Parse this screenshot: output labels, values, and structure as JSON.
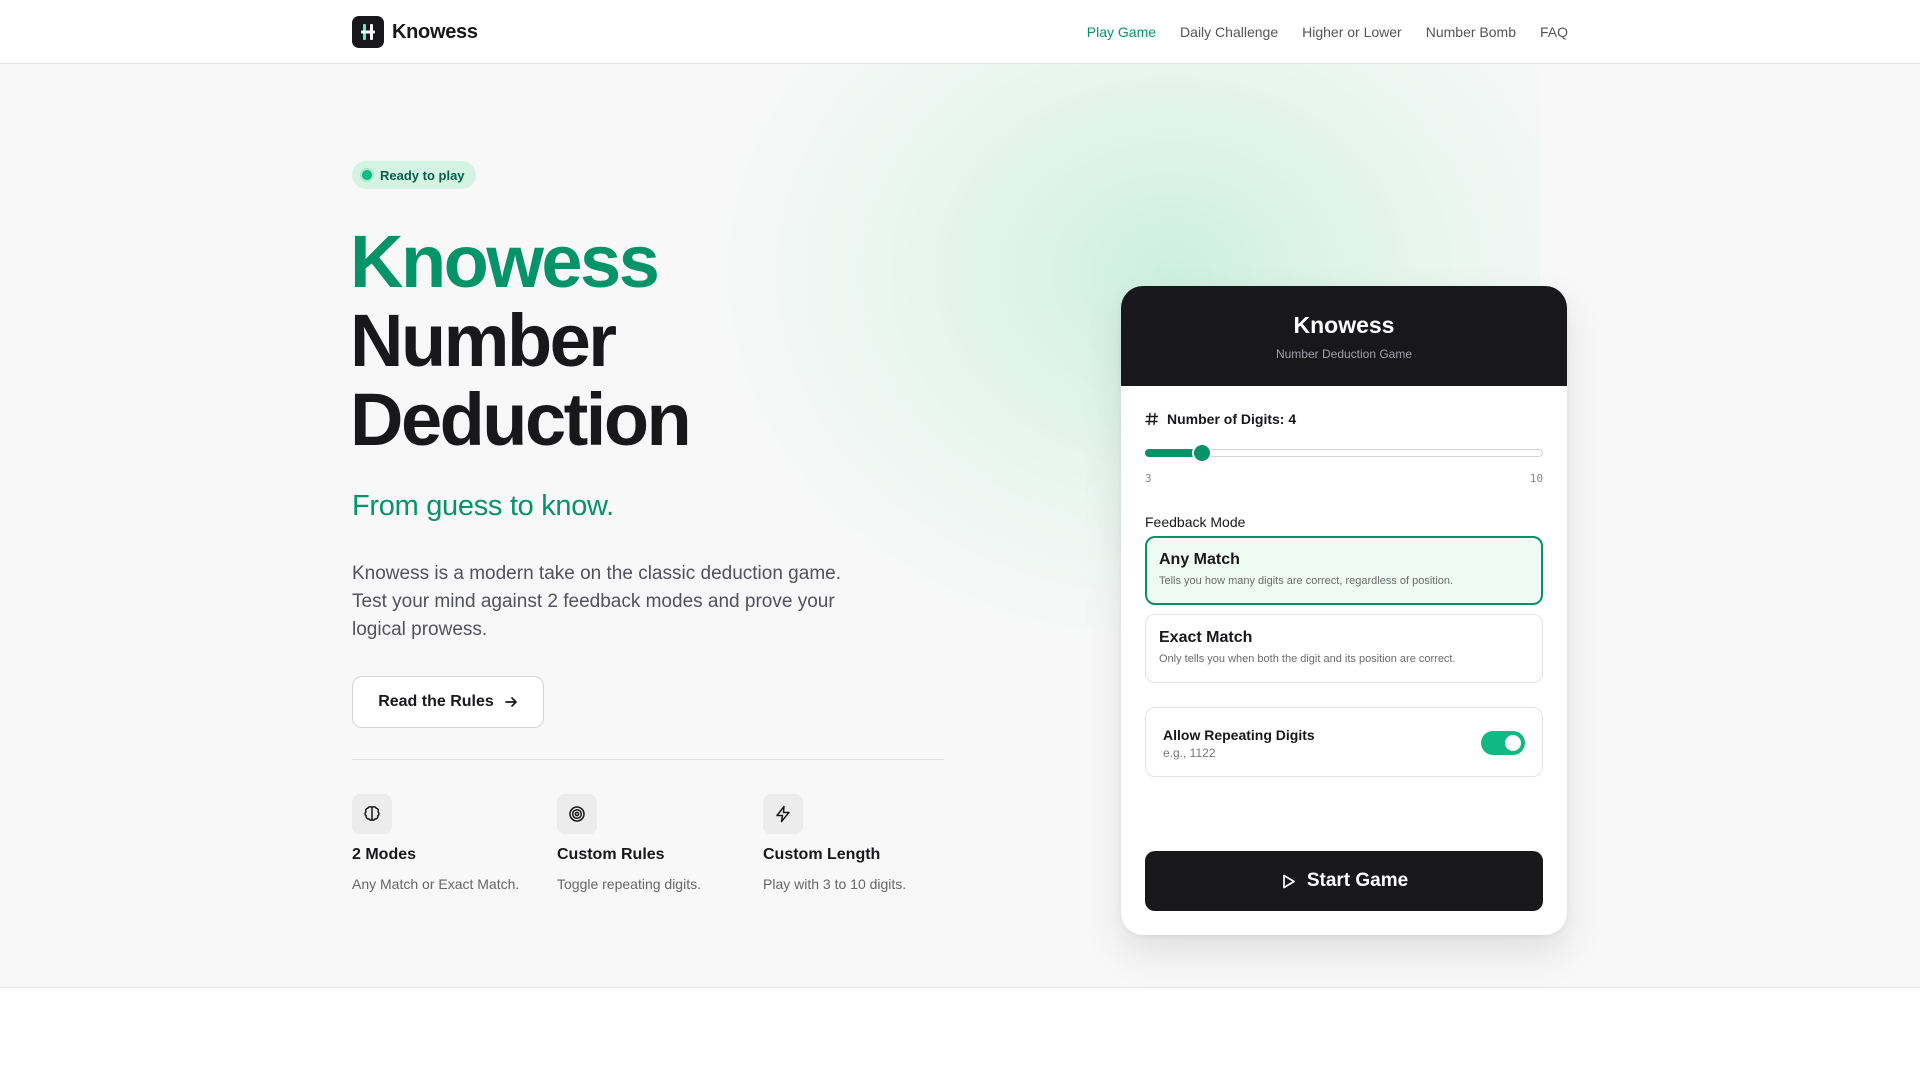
{
  "header": {
    "logo_text": "Knowess",
    "nav": [
      {
        "label": "Play Game",
        "active": true
      },
      {
        "label": "Daily Challenge",
        "active": false
      },
      {
        "label": "Higher or Lower",
        "active": false
      },
      {
        "label": "Number Bomb",
        "active": false
      },
      {
        "label": "FAQ",
        "active": false
      }
    ]
  },
  "hero": {
    "badge": "Ready to play",
    "title_line1": "Knowess",
    "title_line2": "Number",
    "title_line3": "Deduction",
    "tagline": "From guess to know.",
    "description": "Knowess is a modern take on the classic deduction game. Test your mind against 2 feedback modes and prove your logical prowess.",
    "rules_button": "Read the Rules",
    "features": [
      {
        "icon": "brain-icon",
        "title": "2 Modes",
        "subtitle": "Any Match or Exact Match."
      },
      {
        "icon": "target-icon",
        "title": "Custom Rules",
        "subtitle": "Toggle repeating digits."
      },
      {
        "icon": "lightning-icon",
        "title": "Custom Length",
        "subtitle": "Play with 3 to 10 digits."
      }
    ]
  },
  "card": {
    "title": "Knowess",
    "subtitle": "Number Deduction Game",
    "digits_label": "Number of Digits: 4",
    "slider": {
      "min": 3,
      "max": 10,
      "value": 4,
      "min_label": "3",
      "max_label": "10"
    },
    "feedback_label": "Feedback Mode",
    "modes": [
      {
        "title": "Any Match",
        "desc": "Tells you how many digits are correct, regardless of position.",
        "selected": true
      },
      {
        "title": "Exact Match",
        "desc": "Only tells you when both the digit and its position are correct.",
        "selected": false
      }
    ],
    "repeat": {
      "title": "Allow Repeating Digits",
      "example": "e.g., 1122",
      "enabled": true
    },
    "start_button": "Start Game"
  },
  "colors": {
    "accent": "#059467",
    "dark": "#18181b",
    "toggle": "#10b981"
  }
}
